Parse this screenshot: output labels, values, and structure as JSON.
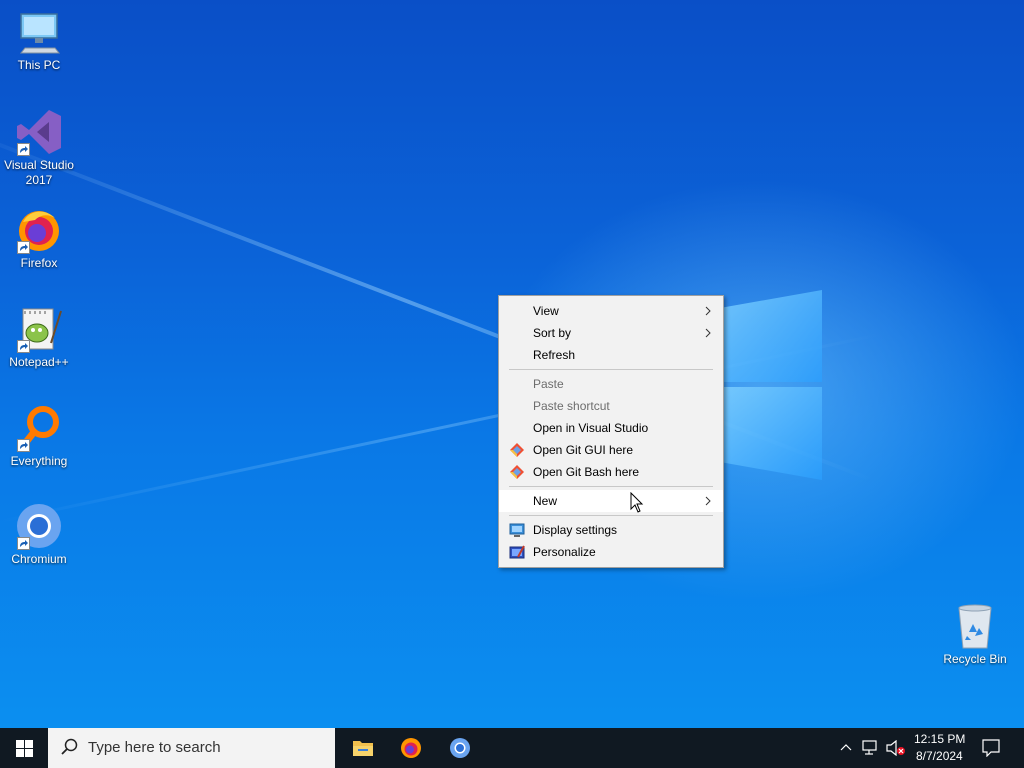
{
  "desktop": {
    "icons": [
      {
        "label_line1": "This PC",
        "label_line2": ""
      },
      {
        "label_line1": "Visual Studio",
        "label_line2": "2017"
      },
      {
        "label_line1": "Firefox",
        "label_line2": ""
      },
      {
        "label_line1": "Notepad++",
        "label_line2": ""
      },
      {
        "label_line1": "Everything",
        "label_line2": ""
      },
      {
        "label_line1": "Chromium",
        "label_line2": ""
      },
      {
        "label_line1": "Recycle Bin",
        "label_line2": ""
      }
    ]
  },
  "context_menu": {
    "items": [
      {
        "label": "View"
      },
      {
        "label": "Sort by"
      },
      {
        "label": "Refresh"
      },
      {
        "label": "Paste"
      },
      {
        "label": "Paste shortcut"
      },
      {
        "label": "Open in Visual Studio"
      },
      {
        "label": "Open Git GUI here"
      },
      {
        "label": "Open Git Bash here"
      },
      {
        "label": "New"
      },
      {
        "label": "Display settings"
      },
      {
        "label": "Personalize"
      }
    ]
  },
  "taskbar": {
    "search_placeholder": "Type here to search",
    "clock_time": "12:15 PM",
    "clock_date": "8/7/2024"
  },
  "colors": {
    "taskbar_bg": "#101922",
    "menu_bg": "#f2f2f2",
    "desktop_accent": "#0a78e6"
  },
  "icons": {
    "start": "windows-logo-icon",
    "search": "magnifier-icon",
    "file_explorer": "folder-icon",
    "firefox": "firefox-icon",
    "chromium": "chromium-icon"
  }
}
